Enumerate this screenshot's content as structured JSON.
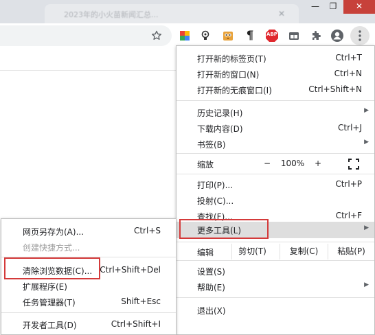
{
  "window": {
    "tab_title": "2023年的小火苗新闻汇总...",
    "tab_close": "✕",
    "minimize": "—",
    "maximize": "❐",
    "close": "✕"
  },
  "toolbar": {
    "abp_label": "ABP",
    "translate_label": "¶"
  },
  "main_menu": {
    "items_top": [
      {
        "label": "打开新的标签页(T)",
        "shortcut": "Ctrl+T"
      },
      {
        "label": "打开新的窗口(N)",
        "shortcut": "Ctrl+N"
      },
      {
        "label": "打开新的无痕窗口(I)",
        "shortcut": "Ctrl+Shift+N"
      }
    ],
    "items_history": [
      {
        "label": "历史记录(H)",
        "arrow": "▶"
      },
      {
        "label": "下载内容(D)",
        "shortcut": "Ctrl+J"
      },
      {
        "label": "书签(B)",
        "arrow": "▶"
      }
    ],
    "zoom": {
      "label": "缩放",
      "minus": "−",
      "value": "100%",
      "plus": "+"
    },
    "items_tools": [
      {
        "label": "打印(P)...",
        "shortcut": "Ctrl+P"
      },
      {
        "label": "投射(C)..."
      },
      {
        "label": "查找(F)...",
        "shortcut": "Ctrl+F"
      },
      {
        "label": "更多工具(L)",
        "arrow": "▶"
      }
    ],
    "edit": {
      "label": "编辑",
      "cut": "剪切(T)",
      "copy": "复制(C)",
      "paste": "粘贴(P)"
    },
    "items_settings": [
      {
        "label": "设置(S)"
      },
      {
        "label": "帮助(E)",
        "arrow": "▶"
      }
    ],
    "exit": {
      "label": "退出(X)"
    }
  },
  "sub_menu": {
    "items": [
      {
        "label": "网页另存为(A)...",
        "shortcut": "Ctrl+S"
      },
      {
        "label": "创建快捷方式..."
      },
      {
        "label": "清除浏览数据(C)...",
        "shortcut": "Ctrl+Shift+Del"
      },
      {
        "label": "扩展程序(E)"
      },
      {
        "label": "任务管理器(T)",
        "shortcut": "Shift+Esc"
      },
      {
        "label": "开发者工具(D)",
        "shortcut": "Ctrl+Shift+I"
      }
    ]
  },
  "colors": {
    "highlight_box": "#d43a3a",
    "close_button": "#c7413a",
    "abp_red": "#e0282e"
  }
}
